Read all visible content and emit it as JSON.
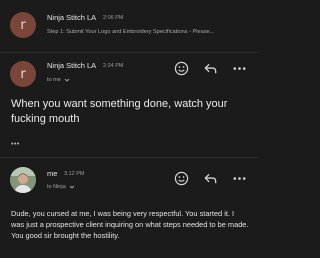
{
  "messages": [
    {
      "avatar_initial": "r",
      "sender": "Ninja Stitch LA",
      "time": "2:06 PM",
      "snippet": "Step 1: Submit Your Logo and Embroidery Specifications - Please..."
    },
    {
      "avatar_initial": "r",
      "sender": "Ninja Stitch LA",
      "time": "2:24 PM",
      "recipient": "to me",
      "body": "When you want something done, watch your fucking mouth",
      "more": "•••"
    },
    {
      "sender": "me",
      "time": "3:12 PM",
      "recipient": "to Ninja",
      "body": "Dude, you cursed at me, I was being very respectful. You started it. I was just a prospective client inquiring on what steps needed to be made. You good sir brought the hostility."
    }
  ],
  "colors": {
    "background": "#1b1b1b",
    "avatar": "#7a4639",
    "text": "#e8e8e8",
    "muted": "#9a9a9a"
  },
  "icons": [
    "emoji-icon",
    "reply-icon",
    "more-icon",
    "chevron-down-icon"
  ]
}
